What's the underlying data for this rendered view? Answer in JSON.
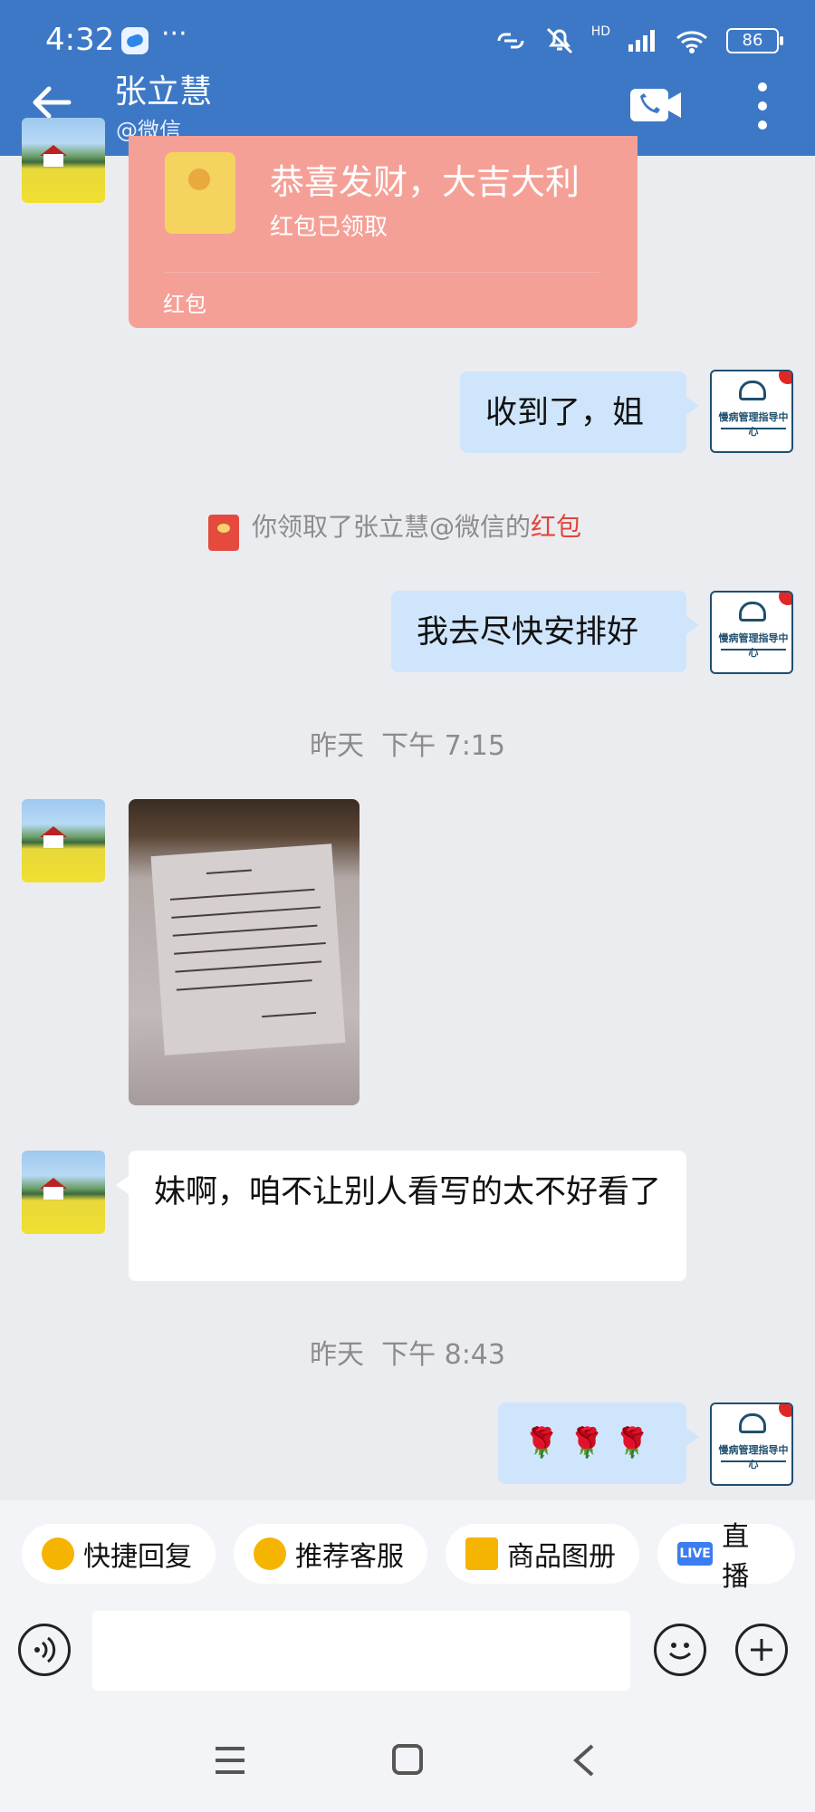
{
  "status_bar": {
    "time": "4:32",
    "dots": "···",
    "signal_label": "HD",
    "battery": "86"
  },
  "header": {
    "title": "张立慧",
    "subtitle": "@微信"
  },
  "messages": {
    "red_packet": {
      "title": "恭喜发财，大吉大利",
      "status": "红包已领取",
      "label": "红包"
    },
    "msg1": "收到了，姐",
    "system": {
      "prefix": "你领取了张立慧@微信的",
      "link": "红包"
    },
    "msg2": "我去尽快安排好",
    "time1": "昨天  下午 7:15",
    "msg3": "妹啊，咱不让别人看写的太不好看了",
    "time2": "昨天  下午 8:43",
    "msg4": "🌹 🌹 🌹"
  },
  "avatar_biz_text": "慢病管理指导中心",
  "quick_replies": [
    {
      "label": "快捷回复",
      "icon": "chat-icon"
    },
    {
      "label": "推荐客服",
      "icon": "chat-icon"
    },
    {
      "label": "商品图册",
      "icon": "doc-icon"
    },
    {
      "label": "直播",
      "icon": "live-icon",
      "badge": "LIVE"
    }
  ],
  "input": {
    "placeholder": ""
  },
  "colors": {
    "header": "#3d78c6",
    "bubble_right": "#cfe5fb",
    "red_packet": "#f5a097"
  }
}
